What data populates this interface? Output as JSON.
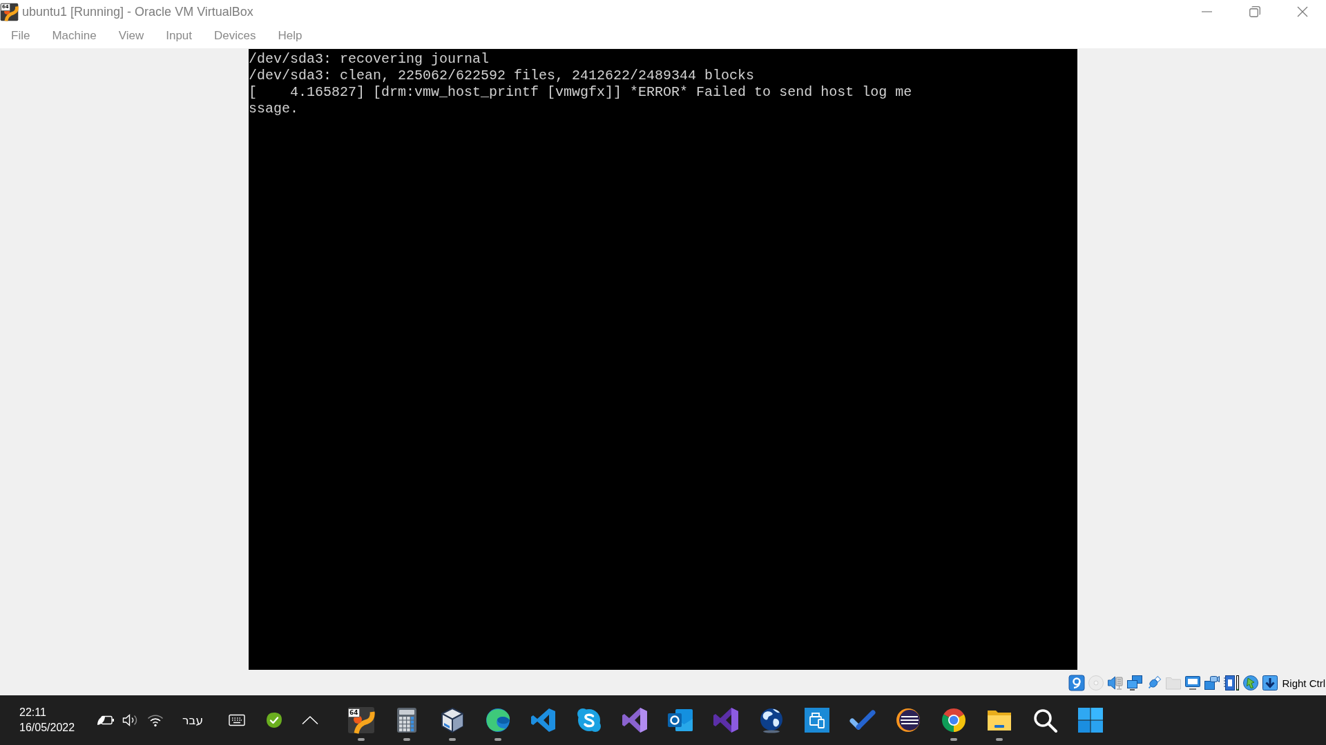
{
  "window": {
    "title": "ubuntu1 [Running] - Oracle VM VirtualBox",
    "icon_badge": "64"
  },
  "menu": [
    "File",
    "Machine",
    "View",
    "Input",
    "Devices",
    "Help"
  ],
  "console": {
    "lines": [
      "/dev/sda3: recovering journal",
      "/dev/sda3: clean, 225062/622592 files, 2412622/2489344 blocks",
      "[    4.165827] [drm:vmw_host_printf [vmwgfx]] *ERROR* Failed to send host log me",
      "ssage."
    ]
  },
  "status_bar": {
    "indicators": [
      {
        "kind": "disk",
        "active": true
      },
      {
        "kind": "optical",
        "active": false
      },
      {
        "kind": "audio",
        "active": true
      },
      {
        "kind": "network",
        "active": true
      },
      {
        "kind": "usb",
        "active": true
      },
      {
        "kind": "shared",
        "active": false
      },
      {
        "kind": "display",
        "active": true
      },
      {
        "kind": "capture",
        "active": true
      },
      {
        "kind": "cpu",
        "active": true
      },
      {
        "kind": "mouse",
        "active": true
      },
      {
        "kind": "keyboard",
        "active": true
      }
    ],
    "host_key": "Right Ctrl"
  },
  "taskbar": {
    "time": "22:11",
    "date": "16/05/2022",
    "language": "עבר",
    "apps": [
      {
        "kind": "vm",
        "badge": "64",
        "running": true
      },
      {
        "kind": "calculator",
        "running": true
      },
      {
        "kind": "cube",
        "running": true
      },
      {
        "kind": "swirl",
        "running": true
      },
      {
        "kind": "editor",
        "running": false
      },
      {
        "kind": "chat",
        "running": false
      },
      {
        "kind": "studio",
        "running": false
      },
      {
        "kind": "mail",
        "running": false
      },
      {
        "kind": "studioalt",
        "running": false
      },
      {
        "kind": "globe",
        "running": false
      },
      {
        "kind": "printer",
        "running": false
      },
      {
        "kind": "tick",
        "running": false
      },
      {
        "kind": "stripes",
        "running": false
      },
      {
        "kind": "browser",
        "running": true
      },
      {
        "kind": "folder",
        "running": true
      },
      {
        "kind": "search",
        "running": false
      },
      {
        "kind": "start",
        "running": false
      }
    ]
  }
}
